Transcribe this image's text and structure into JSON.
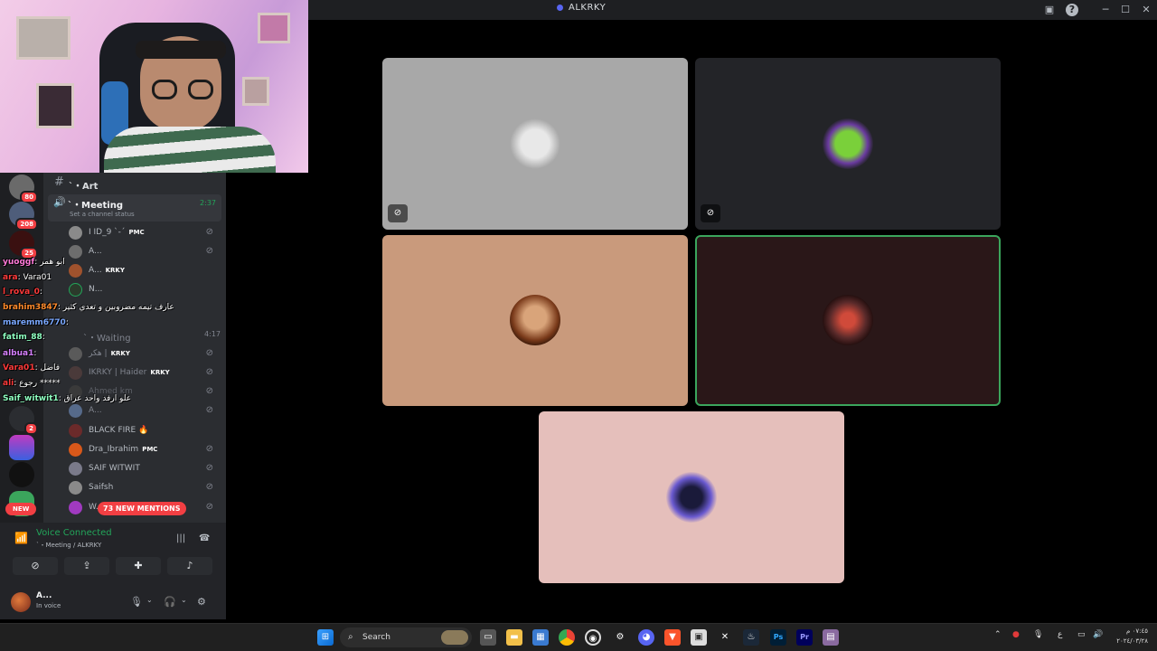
{
  "window": {
    "title": "ALKRKY",
    "icons": [
      "screen-share-icon",
      "help-icon",
      "minimize-icon",
      "maximize-icon",
      "close-icon"
    ]
  },
  "sidebar": {
    "category": "ˋ・Art",
    "voice_channel": {
      "name": "ˋ・Meeting",
      "time": "2:37",
      "status": "Set a channel status"
    },
    "waiting_channel": {
      "name": "ˋ・Waiting",
      "time": "4:17"
    },
    "members": [
      {
        "name": "I ID_9 ˋ-ˊ",
        "badge": "PMC"
      },
      {
        "name": "A...",
        "badge": ""
      },
      {
        "name": "A...",
        "badge": "KRKY"
      },
      {
        "name": "N...",
        "badge": ""
      },
      {
        "name": "هكر |",
        "badge": "KRKY"
      },
      {
        "name": "IKRKY | Haider",
        "badge": "KRKY"
      },
      {
        "name": "Ahmed km",
        "badge": ""
      },
      {
        "name": "A...",
        "badge": ""
      },
      {
        "name": "BLACK FIRE 🔥",
        "badge": ""
      },
      {
        "name": "Dra_Ibrahim",
        "badge": "PMC"
      },
      {
        "name": "SAIF WITWIT",
        "badge": ""
      },
      {
        "name": "Saifsh",
        "badge": ""
      },
      {
        "name": "W...",
        "badge": ""
      }
    ],
    "server_badges": [
      "80",
      "208",
      "25",
      "2"
    ],
    "mentions_label": "73 NEW MENTIONS",
    "new_label": "NEW"
  },
  "chat": [
    {
      "user": "yuoggf",
      "msg": ": ابو همر",
      "color": "#ff7ad9"
    },
    {
      "user": "ara",
      "msg": ": Vara01",
      "color": "#ff3a3a"
    },
    {
      "user": "l_rova_0",
      "msg": ":",
      "color": "#ff3a3a"
    },
    {
      "user": "brahim3847",
      "msg": ": عارف تيمه مضروبين و تعدي كثير",
      "color": "#ff8a2b"
    },
    {
      "user": "maremm6770",
      "msg": ":",
      "color": "#7aa8ff"
    },
    {
      "user": "fatim_88",
      "msg": ":",
      "color": "#8effc0"
    },
    {
      "user": "albua1",
      "msg": ":",
      "color": "#d680ff"
    },
    {
      "user": "Vara01",
      "msg": ": فاضل",
      "color": "#ff3a3a"
    },
    {
      "user": "ali",
      "msg": ": رجوع *****",
      "color": "#ff3a3a"
    },
    {
      "user": "Saif_witwit1",
      "msg": ": علو ارفد واحد عراق",
      "color": "#8effc0"
    }
  ],
  "voice": {
    "status": "Voice Connected",
    "location": "ˋ・Meeting / ALKRKY"
  },
  "user": {
    "name": "A...",
    "status": "In voice"
  },
  "tiles": [
    {
      "bg": "#a8a8a8",
      "muted": true
    },
    {
      "bg": "#232428",
      "muted": true
    },
    {
      "bg": "#c99a7c",
      "muted": false
    },
    {
      "bg": "#2a1718",
      "muted": false,
      "speaking": true
    },
    {
      "bg": "#e5bfbb",
      "muted": false
    }
  ],
  "taskbar": {
    "search": "Search",
    "lang": "ع",
    "time": "٠٧:٤٥ م",
    "date": "٢٠٢٤/٠٣/٢٨"
  }
}
